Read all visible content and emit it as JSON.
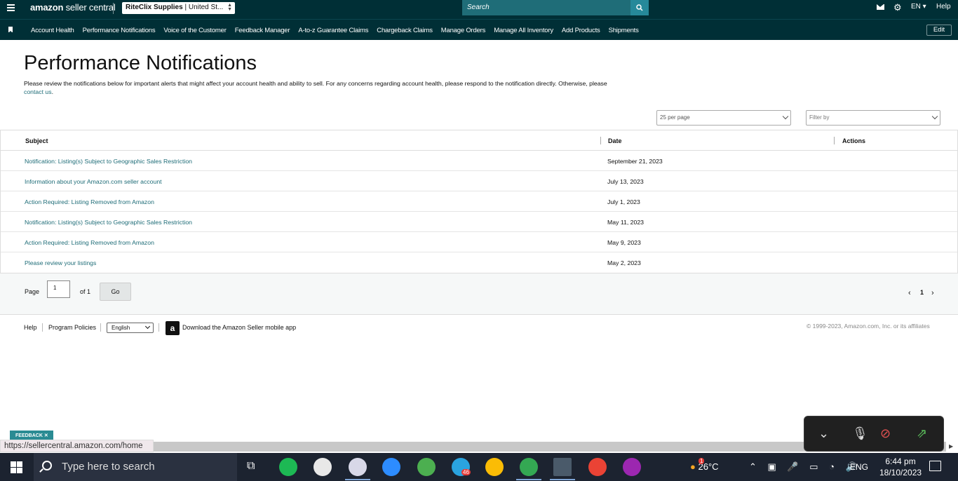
{
  "topbar": {
    "logo_brand": "amazon",
    "logo_suffix": " seller central",
    "store_name": "RiteClix Supplies",
    "store_region": " | United St...",
    "search_placeholder": "Search",
    "language": "EN",
    "help": "Help"
  },
  "nav": {
    "items": [
      "Account Health",
      "Performance Notifications",
      "Voice of the Customer",
      "Feedback Manager",
      "A-to-z Guarantee Claims",
      "Chargeback Claims",
      "Manage Orders",
      "Manage All Inventory",
      "Add Products",
      "Shipments"
    ],
    "edit_label": "Edit"
  },
  "page": {
    "title": "Performance Notifications",
    "description": "Please review the notifications below for important alerts that might affect your account health and ability to sell. For any concerns regarding account health, please respond to the notification directly. Otherwise, please ",
    "contact_link": "contact us",
    "contact_suffix": ".",
    "per_page": "25 per page",
    "filter_placeholder": "Filter by"
  },
  "table": {
    "headers": {
      "subject": "Subject",
      "date": "Date",
      "actions": "Actions"
    },
    "rows": [
      {
        "subject": "Notification: Listing(s) Subject to Geographic Sales Restriction",
        "date": "September 21, 2023"
      },
      {
        "subject": "Information about your Amazon.com seller account",
        "date": "July 13, 2023"
      },
      {
        "subject": "Action Required: Listing Removed from Amazon",
        "date": "July 1, 2023"
      },
      {
        "subject": "Notification: Listing(s) Subject to Geographic Sales Restriction",
        "date": "May 11, 2023"
      },
      {
        "subject": "Action Required: Listing Removed from Amazon",
        "date": "May 9, 2023"
      },
      {
        "subject": "Please review your listings",
        "date": "May 2, 2023"
      }
    ]
  },
  "pagination": {
    "page_label": "Page",
    "current_page": "1",
    "of_label": "of 1",
    "go_label": "Go",
    "page_number": "1"
  },
  "footer": {
    "help": "Help",
    "program_policies": "Program Policies",
    "language": "English",
    "app_download": "Download the Amazon Seller mobile app",
    "copyright": "© 1999-2023, Amazon.com, Inc. or its affiliates"
  },
  "feedback_label": "FEEDBACK ✕",
  "status_url": "https://sellercentral.amazon.com/home",
  "taskbar": {
    "search_placeholder": "Type here to search",
    "weather": "26°C",
    "language": "ENG",
    "time": "6:44 pm",
    "date": "18/10/2023",
    "telegram_badge": "46",
    "weather_badge": "1"
  },
  "colors": {
    "header_bg": "#002f36",
    "link": "#1f6d78",
    "search_bg": "#1f6d78"
  }
}
